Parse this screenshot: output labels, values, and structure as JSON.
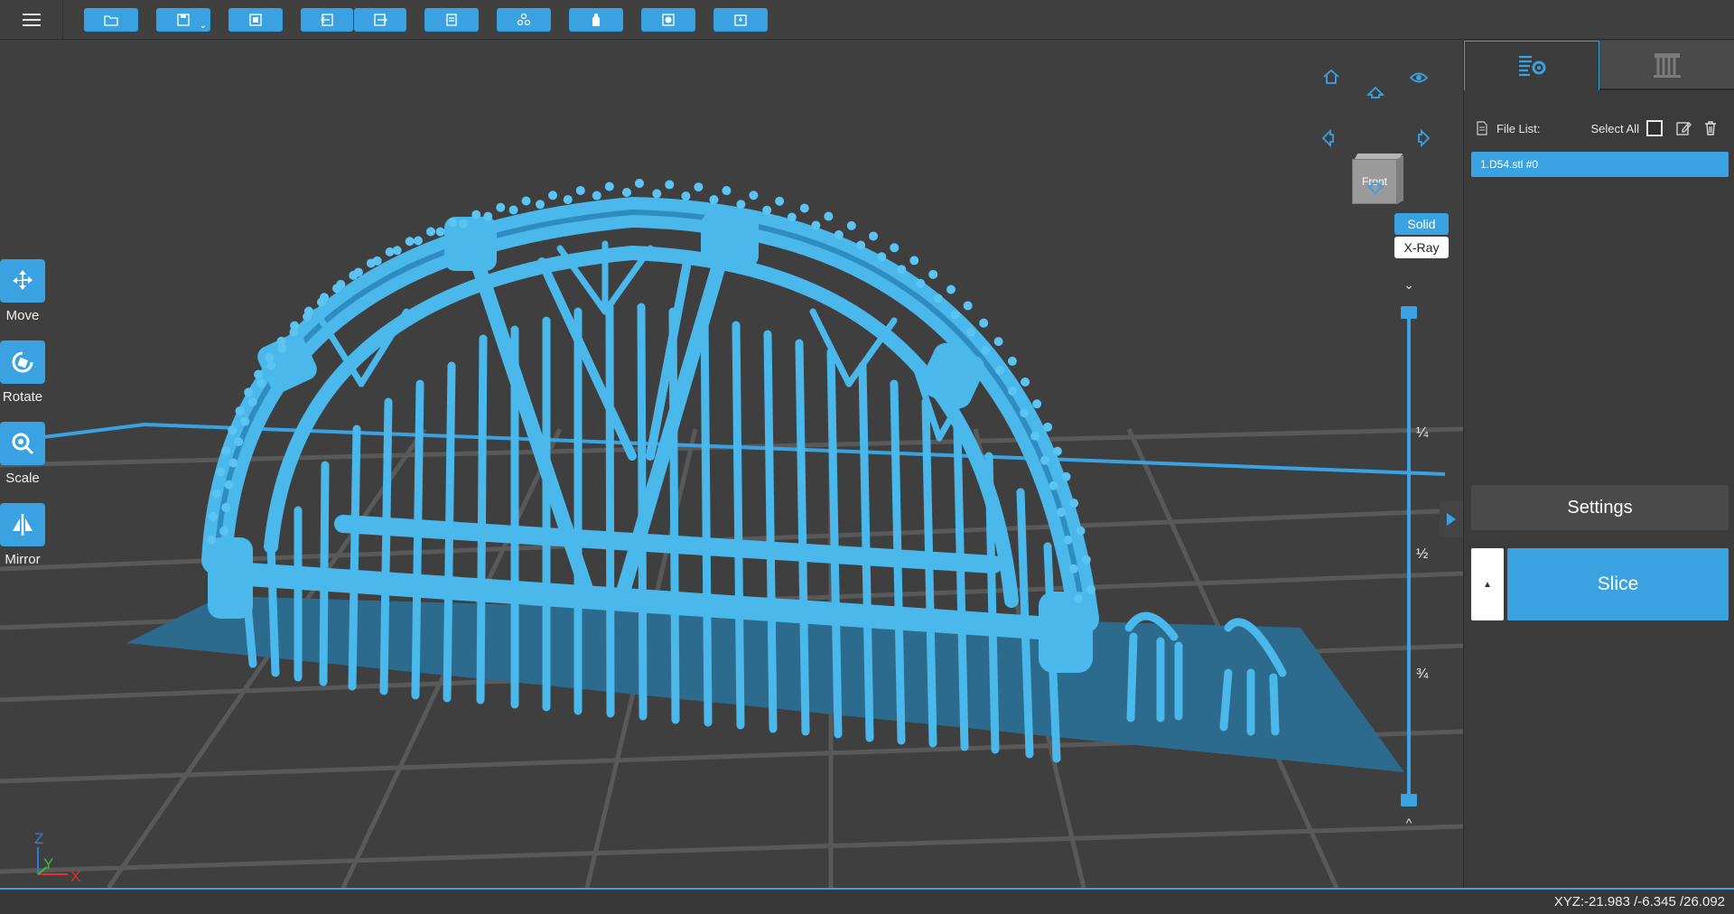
{
  "toolbar": {
    "buttons": [
      {
        "name": "open-file",
        "icon": "folder-icon"
      },
      {
        "name": "save",
        "icon": "save-icon"
      },
      {
        "name": "print-area",
        "icon": "frame-icon"
      },
      {
        "name": "import",
        "icon": "import-icon"
      },
      {
        "name": "export",
        "icon": "export-icon"
      },
      {
        "name": "layout",
        "icon": "document-icon"
      },
      {
        "name": "supports",
        "icon": "tree-icon"
      },
      {
        "name": "hollow",
        "icon": "bottle-icon"
      },
      {
        "name": "drill",
        "icon": "square-dot-icon"
      },
      {
        "name": "base",
        "icon": "plate-icon"
      }
    ]
  },
  "left_tools": [
    {
      "label": "Move",
      "icon": "move-icon"
    },
    {
      "label": "Rotate",
      "icon": "rotate-icon"
    },
    {
      "label": "Scale",
      "icon": "scale-icon"
    },
    {
      "label": "Mirror",
      "icon": "mirror-icon"
    }
  ],
  "view": {
    "cube_face": "Front",
    "mode_solid": "Solid",
    "mode_xray": "X-Ray",
    "active_mode": "Solid"
  },
  "layer_slider": {
    "marks": [
      "¼",
      "½",
      "¾"
    ],
    "top_value": 1.0,
    "bottom_value": 0.0
  },
  "axes": {
    "z": "Z",
    "y": "Y",
    "x": "X"
  },
  "right_panel": {
    "file_list_label": "File List:",
    "select_all_label": "Select All",
    "files": [
      "1.D54.stl #0"
    ],
    "settings_label": "Settings",
    "slice_label": "Slice"
  },
  "status": {
    "xyz": "XYZ:-21.983 /-6.345 /26.092"
  },
  "colors": {
    "accent": "#3aa2e0",
    "model": "#4ab8ea",
    "background": "#3f3f3f",
    "build_plate": "#2c6a8e"
  }
}
